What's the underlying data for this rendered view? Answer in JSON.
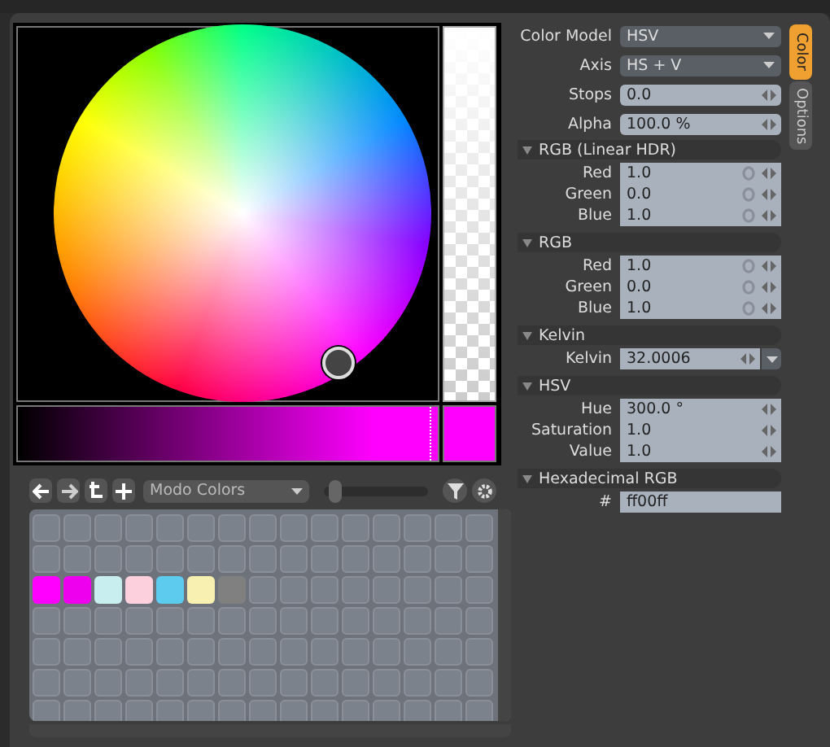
{
  "toolbar": {
    "preset": "Modo Colors",
    "zoom": {
      "level": 0.05
    }
  },
  "swatches": [
    {
      "color": "#ff00ff"
    },
    {
      "color": "#ee00ee"
    },
    {
      "color": "#c8eef0"
    },
    {
      "color": "#fcd0dc"
    },
    {
      "color": "#5ccbee"
    },
    {
      "color": "#f8f0b0"
    },
    {
      "color": "#808080"
    }
  ],
  "tabs": [
    {
      "label": "Color",
      "selected": true
    },
    {
      "label": "Options",
      "selected": false
    }
  ],
  "top_rows": [
    {
      "kind": "dropdown",
      "label": "Color Model",
      "value": "HSV"
    },
    {
      "kind": "dropdown",
      "label": "Axis",
      "value": "HS + V"
    },
    {
      "kind": "spinner",
      "label": "Stops",
      "value": "0.0"
    },
    {
      "kind": "spinner",
      "label": "Alpha",
      "value": "100.0 %"
    }
  ],
  "sections": [
    {
      "title": "RGB (Linear HDR)",
      "expanded": true,
      "rows": [
        {
          "kind": "channel",
          "label": "Red",
          "value": "1.0"
        },
        {
          "kind": "channel",
          "label": "Green",
          "value": "0.0"
        },
        {
          "kind": "channel",
          "label": "Blue",
          "value": "1.0"
        }
      ]
    },
    {
      "title": "RGB",
      "expanded": true,
      "rows": [
        {
          "kind": "channel",
          "label": "Red",
          "value": "1.0"
        },
        {
          "kind": "channel",
          "label": "Green",
          "value": "0.0"
        },
        {
          "kind": "channel",
          "label": "Blue",
          "value": "1.0"
        }
      ]
    },
    {
      "title": "Kelvin",
      "expanded": true,
      "rows": [
        {
          "kind": "spinner_dropdown",
          "label": "Kelvin",
          "value": "32.0006"
        }
      ]
    },
    {
      "title": "HSV",
      "expanded": true,
      "rows": [
        {
          "kind": "spinner",
          "label": "Hue",
          "value": "300.0 °"
        },
        {
          "kind": "spinner",
          "label": "Saturation",
          "value": "1.0"
        },
        {
          "kind": "spinner",
          "label": "Value",
          "value": "1.0"
        }
      ]
    },
    {
      "title": "Hexadecimal RGB",
      "expanded": true,
      "rows": [
        {
          "kind": "text",
          "label": "#",
          "value": "ff00ff"
        }
      ]
    }
  ]
}
